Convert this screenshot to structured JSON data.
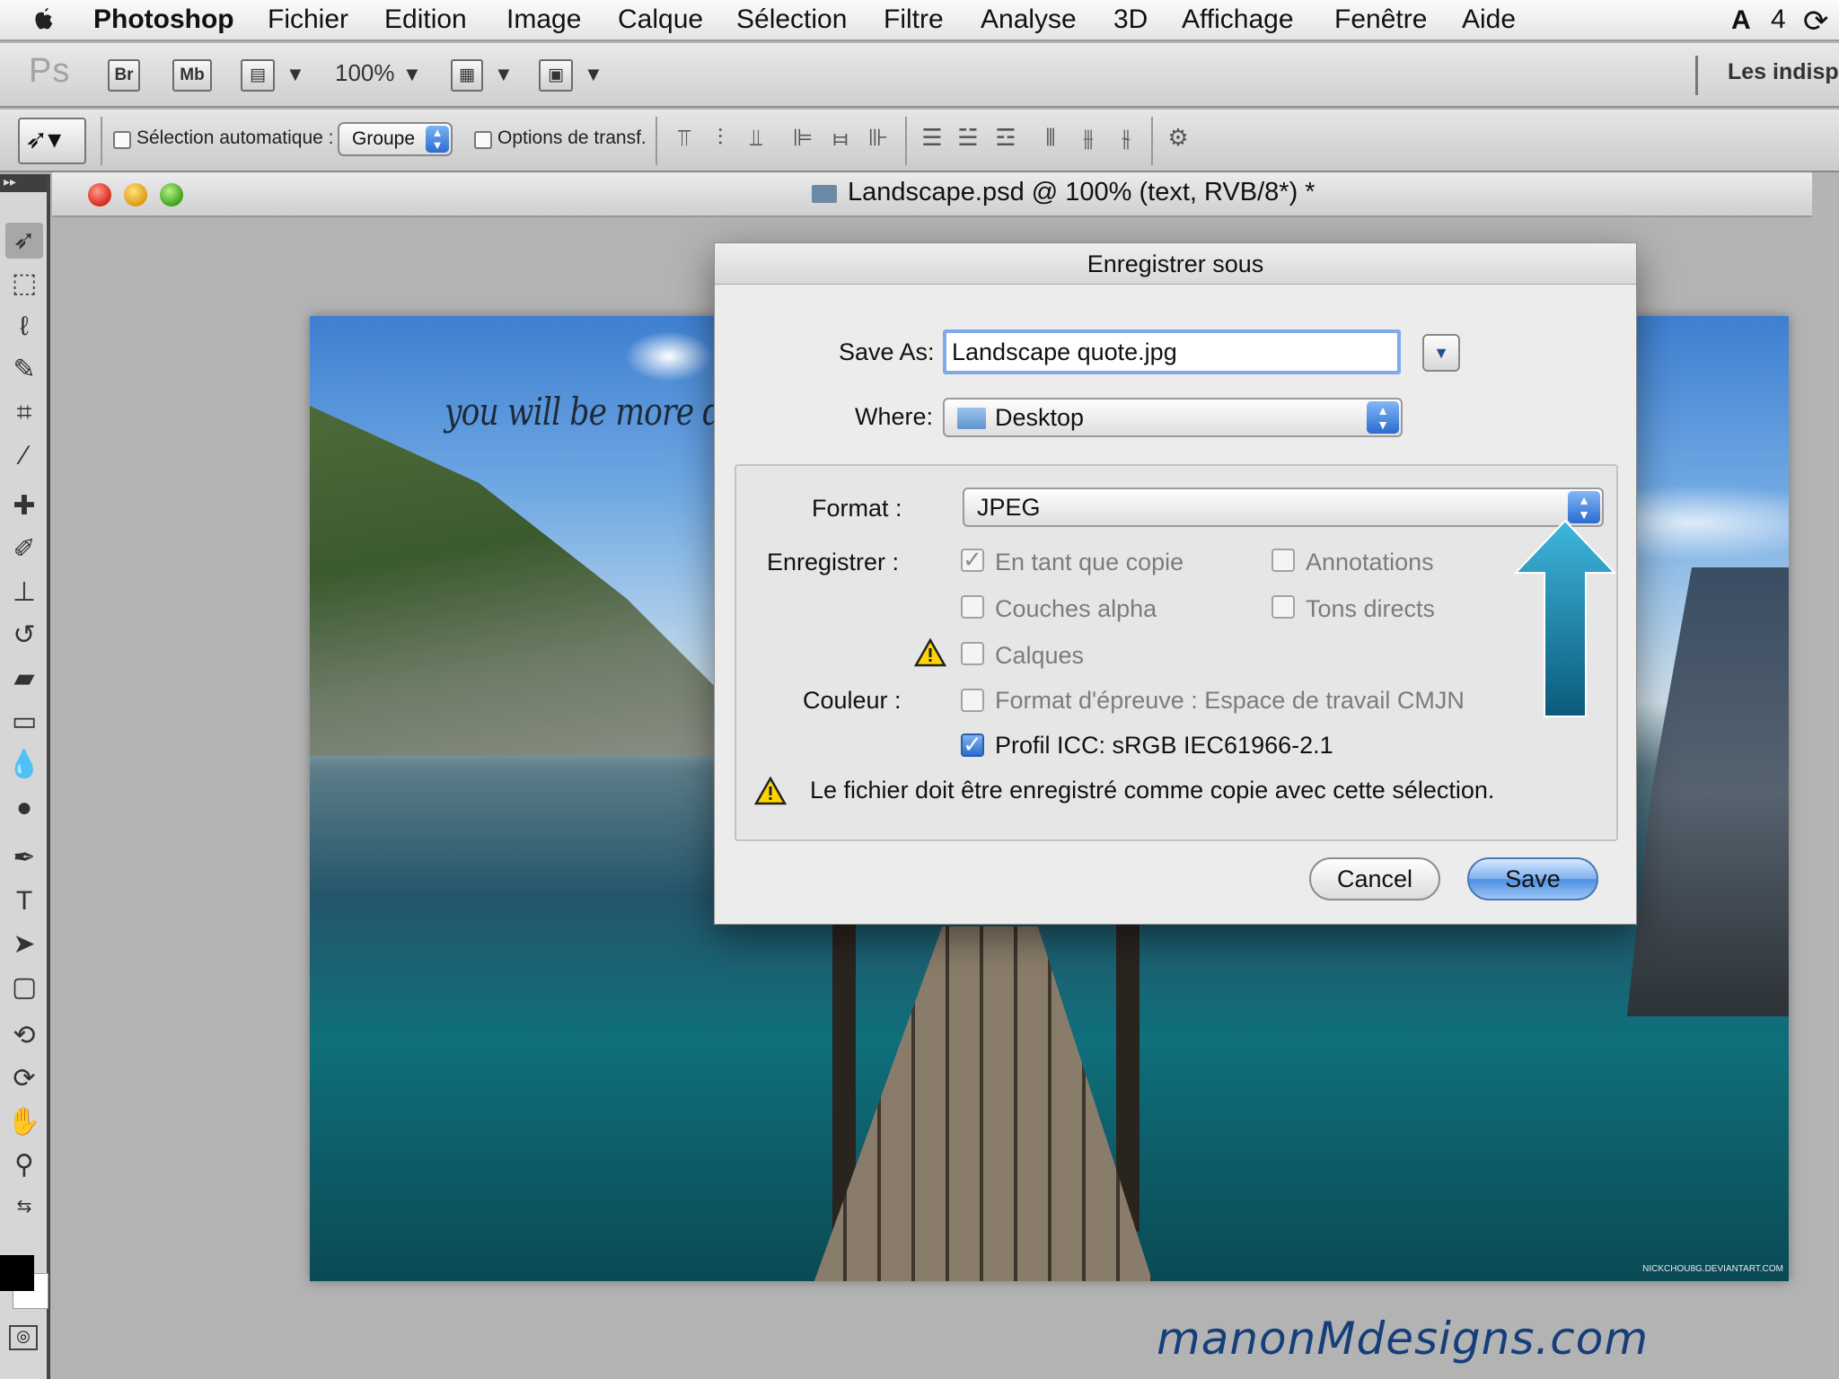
{
  "menubar": {
    "app_name": "Photoshop",
    "items": [
      "Fichier",
      "Edition",
      "Image",
      "Calque",
      "Sélection",
      "Filtre",
      "Analyse",
      "3D",
      "Affichage",
      "Fenêtre",
      "Aide"
    ],
    "status_icon_label": "4"
  },
  "appbar": {
    "logo": "Ps",
    "bridge_label": "Br",
    "minibridge_label": "Mb",
    "zoom": "100%",
    "workspace": "Les indisp"
  },
  "optionsbar": {
    "auto_select_label": "Sélection automatique :",
    "auto_select_value": "Groupe",
    "transform_controls_label": "Options de transf."
  },
  "document": {
    "title": "Landscape.psd @ 100% (text, RVB/8*) *",
    "canvas_quote": "you will be more disa",
    "credit": "NICKCHOU8G.DEVIANTART.COM"
  },
  "dialog": {
    "title": "Enregistrer sous",
    "save_as_label": "Save As:",
    "save_as_value": "Landscape quote.jpg",
    "where_label": "Where:",
    "where_value": "Desktop",
    "format_label": "Format :",
    "format_value": "JPEG",
    "enregistrer_label": "Enregistrer :",
    "options": {
      "copy": "En tant que copie",
      "annotations": "Annotations",
      "alpha": "Couches alpha",
      "spot": "Tons directs",
      "layers": "Calques"
    },
    "couleur_label": "Couleur :",
    "proof_label": "Format d'épreuve : Espace de travail CMJN",
    "icc_label": "Profil ICC:  sRGB IEC61966-2.1",
    "warning": "Le fichier doit être enregistré comme copie avec cette sélection.",
    "cancel_label": "Cancel",
    "save_label": "Save"
  },
  "watermark": "manonMdesigns.com",
  "colors": {
    "accent_blue": "#2d6cd0",
    "arrow_teal": "#1a8fb3",
    "watermark": "#153e7a"
  }
}
